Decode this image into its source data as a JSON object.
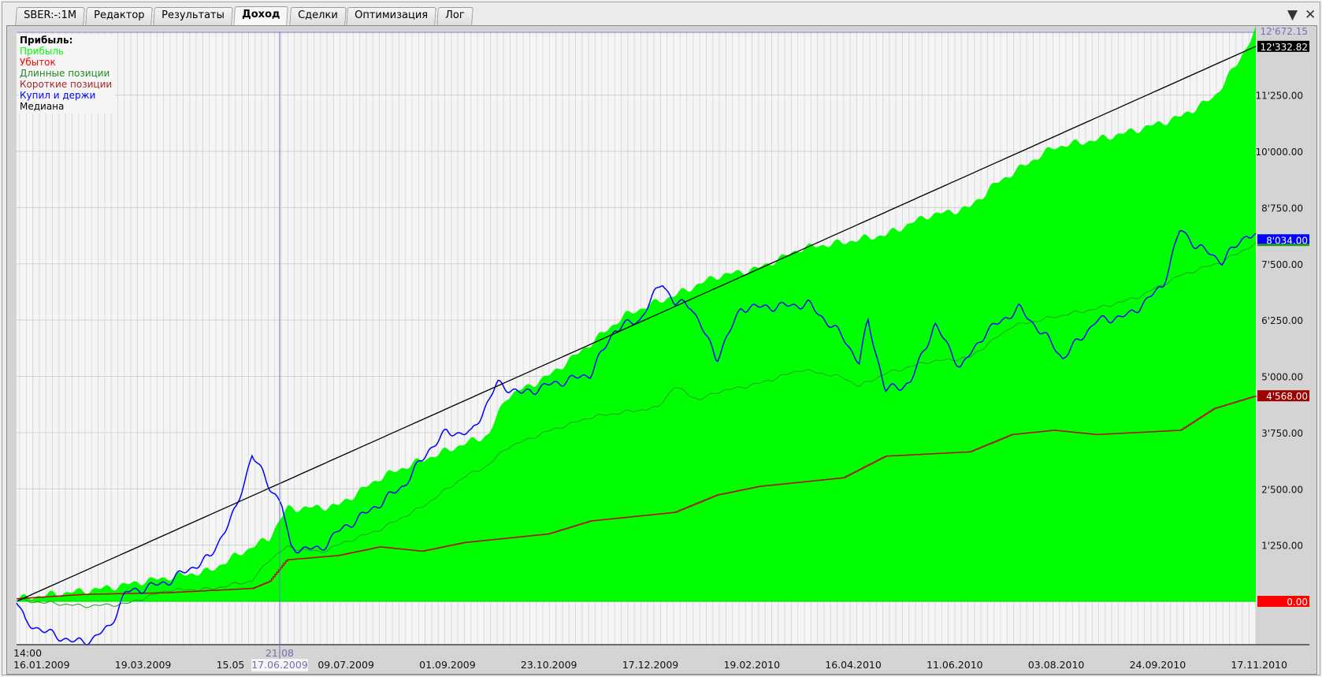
{
  "tabs": [
    {
      "label": "SBER:-:1M"
    },
    {
      "label": "Редактор"
    },
    {
      "label": "Результаты"
    },
    {
      "label": "Доход",
      "active": true
    },
    {
      "label": "Сделки"
    },
    {
      "label": "Оптимизация"
    },
    {
      "label": "Лог"
    }
  ],
  "window_controls": {
    "menu_icon": "▼",
    "close_icon": "✕"
  },
  "legend": {
    "title": "Прибыль:",
    "items": [
      {
        "label": "Прибыль",
        "color": "#00ff00"
      },
      {
        "label": "Убыток",
        "color": "#ff0000"
      },
      {
        "label": "Длинные позиции",
        "color": "#228b22"
      },
      {
        "label": "Короткие позиции",
        "color": "#a52a2a"
      },
      {
        "label": "Купил и держи",
        "color": "#0000ff"
      },
      {
        "label": "Медиана",
        "color": "#000000"
      }
    ]
  },
  "crosshair": {
    "time": "21:08",
    "date": "17.06.2009",
    "value": "12'672.15"
  },
  "chart_data": {
    "type": "area",
    "x_unit": "percent of period",
    "xlabels": [
      "16.01.2009",
      "19.03.2009",
      "15.05",
      "09.07.2009",
      "01.09.2009",
      "23.10.2009",
      "17.12.2009",
      "19.02.2010",
      "16.04.2010",
      "11.06.2010",
      "03.08.2010",
      "24.09.2010",
      "17.11.2010"
    ],
    "first_time": "14:00",
    "yticks": [
      "0.00",
      "1'250.00",
      "2'500.00",
      "3'750.00",
      "5'000.00",
      "6'250.00",
      "7'500.00",
      "8'750.00",
      "10'000.00",
      "11'250.00"
    ],
    "ylim": [
      -1000,
      12672
    ],
    "end_labels": {
      "median": "12'332.82",
      "buy_hold": "8'034.00",
      "short": "4'568.00",
      "zero": "0.00"
    },
    "series": [
      {
        "name": "Прибыль",
        "color": "#00ff00",
        "points": [
          [
            0,
            0
          ],
          [
            10.2,
            480
          ],
          [
            15.6,
            634
          ],
          [
            20.4,
            1402
          ],
          [
            21.8,
            2074
          ],
          [
            25.9,
            2170
          ],
          [
            29.3,
            2746
          ],
          [
            34,
            3226
          ],
          [
            38.1,
            3706
          ],
          [
            39.5,
            4570
          ],
          [
            42.9,
            5050
          ],
          [
            46.3,
            5722
          ],
          [
            49,
            6298
          ],
          [
            53.1,
            6778
          ],
          [
            56.5,
            7258
          ],
          [
            59.9,
            7450
          ],
          [
            63.3,
            7834
          ],
          [
            66.7,
            7930
          ],
          [
            70.1,
            8122
          ],
          [
            73.5,
            8602
          ],
          [
            76.9,
            8794
          ],
          [
            78.9,
            9274
          ],
          [
            83.7,
            10042
          ],
          [
            87.1,
            10234
          ],
          [
            90.5,
            10522
          ],
          [
            93.9,
            10810
          ],
          [
            96.6,
            11194
          ],
          [
            98.6,
            11962
          ],
          [
            100,
            12672
          ]
        ]
      },
      {
        "name": "Длинные позиции",
        "color": "#1f9e1f",
        "points": [
          [
            0,
            0
          ],
          [
            5.4,
            -96
          ],
          [
            8.8,
            -38
          ],
          [
            12.2,
            250
          ],
          [
            15.6,
            250
          ],
          [
            19,
            442
          ],
          [
            20.4,
            922
          ],
          [
            21.8,
            1210
          ],
          [
            24.5,
            1114
          ],
          [
            27.2,
            1402
          ],
          [
            29.3,
            1594
          ],
          [
            32.7,
            2074
          ],
          [
            36.1,
            2746
          ],
          [
            38.1,
            3034
          ],
          [
            39.5,
            3418
          ],
          [
            42.9,
            3802
          ],
          [
            46.3,
            4090
          ],
          [
            49,
            4186
          ],
          [
            51.7,
            4282
          ],
          [
            53.1,
            4762
          ],
          [
            55.1,
            4474
          ],
          [
            56.5,
            4666
          ],
          [
            59.9,
            4858
          ],
          [
            63.3,
            5146
          ],
          [
            66.7,
            4954
          ],
          [
            68,
            4762
          ],
          [
            70.1,
            5050
          ],
          [
            73.5,
            5338
          ],
          [
            76.9,
            5434
          ],
          [
            80.3,
            6106
          ],
          [
            83.7,
            6298
          ],
          [
            87.1,
            6490
          ],
          [
            90.5,
            6778
          ],
          [
            93.9,
            7258
          ],
          [
            97.3,
            7546
          ],
          [
            100,
            7930
          ]
        ]
      },
      {
        "name": "Короткие позиции",
        "color": "#b01010",
        "points": [
          [
            0,
            58
          ],
          [
            5.4,
            154
          ],
          [
            12.2,
            192
          ],
          [
            19,
            288
          ],
          [
            20.4,
            442
          ],
          [
            21.8,
            922
          ],
          [
            25.9,
            1018
          ],
          [
            29.3,
            1210
          ],
          [
            32.7,
            1114
          ],
          [
            36.1,
            1306
          ],
          [
            42.9,
            1498
          ],
          [
            46.3,
            1786
          ],
          [
            53.1,
            1978
          ],
          [
            56.5,
            2362
          ],
          [
            59.9,
            2554
          ],
          [
            66.7,
            2746
          ],
          [
            70.1,
            3226
          ],
          [
            76.9,
            3322
          ],
          [
            80.3,
            3706
          ],
          [
            83.7,
            3802
          ],
          [
            87.1,
            3706
          ],
          [
            93.9,
            3802
          ],
          [
            96.6,
            4282
          ],
          [
            100,
            4568
          ]
        ]
      },
      {
        "name": "Купил и держи",
        "color": "#0000ff",
        "points": [
          [
            0,
            -38
          ],
          [
            0.7,
            -518
          ],
          [
            2.7,
            -749
          ],
          [
            4.8,
            -902
          ],
          [
            6.1,
            -806
          ],
          [
            7.5,
            -518
          ],
          [
            8.8,
            250
          ],
          [
            12.2,
            442
          ],
          [
            15.6,
            922
          ],
          [
            17.7,
            1978
          ],
          [
            19,
            3226
          ],
          [
            20.4,
            2554
          ],
          [
            21.4,
            2170
          ],
          [
            22.1,
            1210
          ],
          [
            24.5,
            1210
          ],
          [
            25.9,
            1594
          ],
          [
            29.3,
            2170
          ],
          [
            31.3,
            2554
          ],
          [
            33.3,
            3322
          ],
          [
            34.7,
            3706
          ],
          [
            36.7,
            3706
          ],
          [
            38.8,
            4858
          ],
          [
            40.8,
            4666
          ],
          [
            42.9,
            4858
          ],
          [
            46.3,
            5050
          ],
          [
            48.3,
            6010
          ],
          [
            50.3,
            6202
          ],
          [
            52.1,
            7066
          ],
          [
            53.1,
            6586
          ],
          [
            54.4,
            6586
          ],
          [
            56.5,
            5434
          ],
          [
            58.5,
            6586
          ],
          [
            61.2,
            6586
          ],
          [
            63.9,
            6586
          ],
          [
            66.7,
            5818
          ],
          [
            68,
            5242
          ],
          [
            68.7,
            6202
          ],
          [
            70.1,
            4666
          ],
          [
            72.1,
            4858
          ],
          [
            74.1,
            6202
          ],
          [
            76.2,
            5242
          ],
          [
            78.2,
            6010
          ],
          [
            80.9,
            6490
          ],
          [
            83.7,
            5626
          ],
          [
            84.4,
            5338
          ],
          [
            87.1,
            6202
          ],
          [
            89.8,
            6394
          ],
          [
            92.5,
            7066
          ],
          [
            93.9,
            8314
          ],
          [
            95.2,
            7930
          ],
          [
            97.3,
            7546
          ],
          [
            99.3,
            8122
          ],
          [
            100,
            8034
          ]
        ]
      },
      {
        "name": "Медиана",
        "color": "#000000",
        "points": [
          [
            0,
            0
          ],
          [
            100,
            12332.82
          ]
        ]
      }
    ]
  }
}
